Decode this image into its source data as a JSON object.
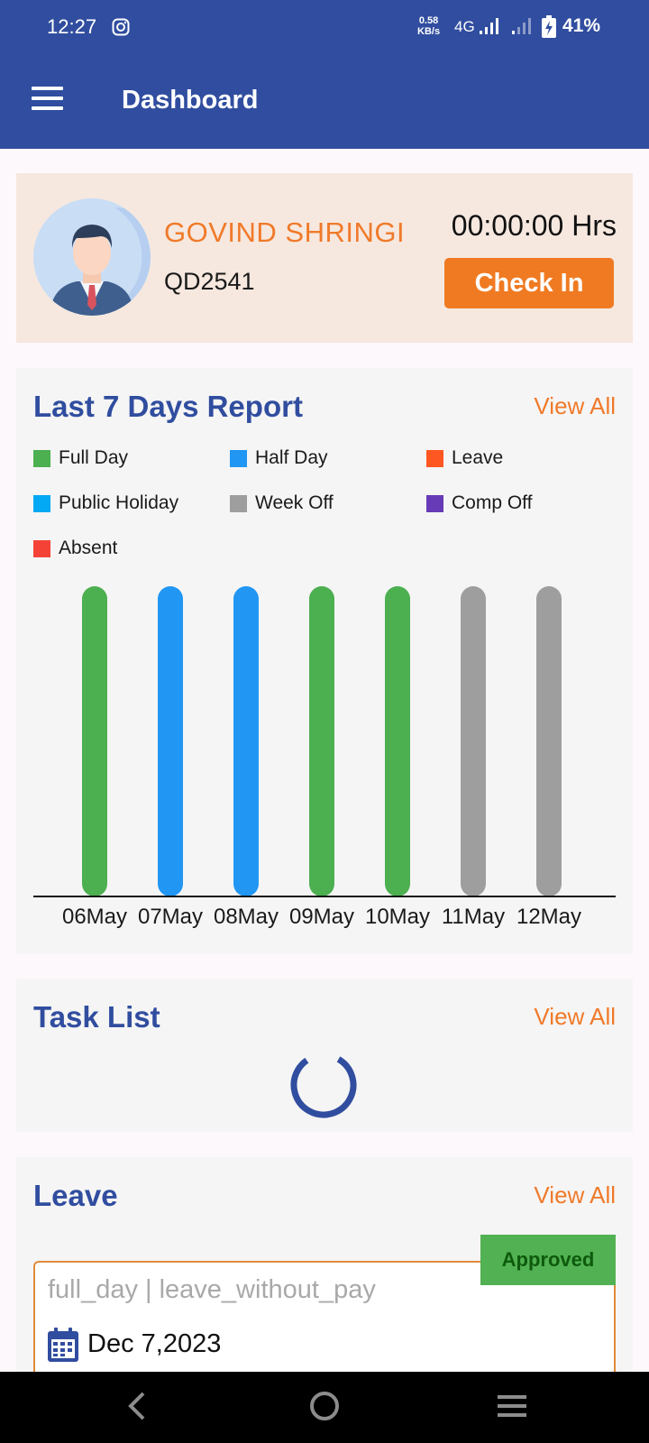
{
  "status_bar": {
    "time": "12:27",
    "speed_value": "0.58",
    "speed_unit": "KB/s",
    "network": "4G",
    "battery": "41%"
  },
  "app_bar": {
    "title": "Dashboard"
  },
  "profile": {
    "name": "GOVIND SHRINGI",
    "employee_id": "QD2541",
    "timer": "00:00:00 Hrs",
    "check_in_label": "Check In"
  },
  "report": {
    "title": "Last 7 Days Report",
    "view_all": "View All",
    "legend": [
      {
        "label": "Full Day",
        "color": "#4caf50"
      },
      {
        "label": "Half Day",
        "color": "#2196f3"
      },
      {
        "label": "Leave",
        "color": "#ff5722"
      },
      {
        "label": "Public Holiday",
        "color": "#03a9f4"
      },
      {
        "label": "Week Off",
        "color": "#9e9e9e"
      },
      {
        "label": "Comp Off",
        "color": "#673ab7"
      },
      {
        "label": "Absent",
        "color": "#f44336"
      }
    ]
  },
  "chart_data": {
    "type": "bar",
    "categories": [
      "06May",
      "07May",
      "08May",
      "09May",
      "10May",
      "11May",
      "12May"
    ],
    "values": [
      1,
      1,
      1,
      1,
      1,
      1,
      1
    ],
    "status": [
      "Full Day",
      "Half Day",
      "Half Day",
      "Full Day",
      "Full Day",
      "Week Off",
      "Week Off"
    ],
    "bar_colors": [
      "#4caf50",
      "#2196f3",
      "#2196f3",
      "#4caf50",
      "#4caf50",
      "#9e9e9e",
      "#9e9e9e"
    ],
    "ylim": [
      0,
      1
    ],
    "grid": false
  },
  "task_list": {
    "title": "Task List",
    "view_all": "View All"
  },
  "leave": {
    "title": "Leave",
    "view_all": "View All",
    "items": [
      {
        "type": "full_day | leave_without_pay",
        "date": "Dec 7,2023",
        "status": "Approved",
        "status_color": "#52b152"
      }
    ]
  },
  "nav_bar": {
    "icons": [
      "back-icon",
      "home-icon",
      "recent-apps-icon"
    ]
  }
}
